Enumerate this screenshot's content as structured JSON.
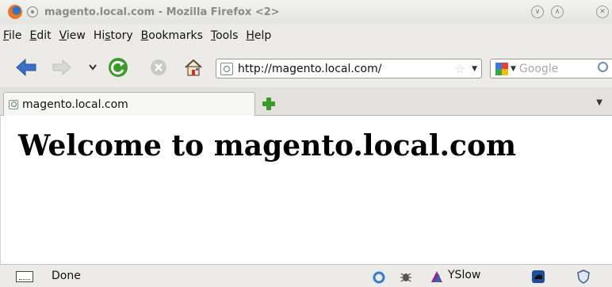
{
  "window": {
    "title": "magento.local.com - Mozilla Firefox <2>",
    "icons": [
      "firefox-icon",
      "pin-icon",
      "minimize-icon",
      "maximize-icon",
      "close-icon"
    ]
  },
  "menu": {
    "items": [
      {
        "mnemonic": "F",
        "rest": "ile"
      },
      {
        "mnemonic": "E",
        "rest": "dit"
      },
      {
        "mnemonic": "V",
        "rest": "iew"
      },
      {
        "prefix": "Hi",
        "mnemonic": "s",
        "rest": "tory"
      },
      {
        "mnemonic": "B",
        "rest": "ookmarks"
      },
      {
        "mnemonic": "T",
        "rest": "ools"
      },
      {
        "mnemonic": "H",
        "rest": "elp"
      }
    ]
  },
  "nav": {
    "url": "http://magento.local.com/",
    "search_placeholder": "Google",
    "icons": [
      "back-icon",
      "forward-icon",
      "history-dropdown-icon",
      "reload-icon",
      "stop-icon",
      "home-icon",
      "site-identity-icon",
      "bookmark-star-icon",
      "search-engine-icon",
      "search-icon"
    ]
  },
  "tabs": {
    "items": [
      {
        "label": "magento.local.com"
      }
    ]
  },
  "page": {
    "heading": "Welcome to magento.local.com"
  },
  "status": {
    "text": "Done",
    "yslow_label": "YSlow",
    "icons": [
      "status-screen-icon",
      "sync-icon",
      "firebug-icon",
      "yslow-icon",
      "addon-icon",
      "shield-icon"
    ]
  },
  "colors": {
    "back_arrow": "#3d6fc4",
    "reload": "#3c9a2a",
    "new_tab": "#3c9a2a"
  }
}
